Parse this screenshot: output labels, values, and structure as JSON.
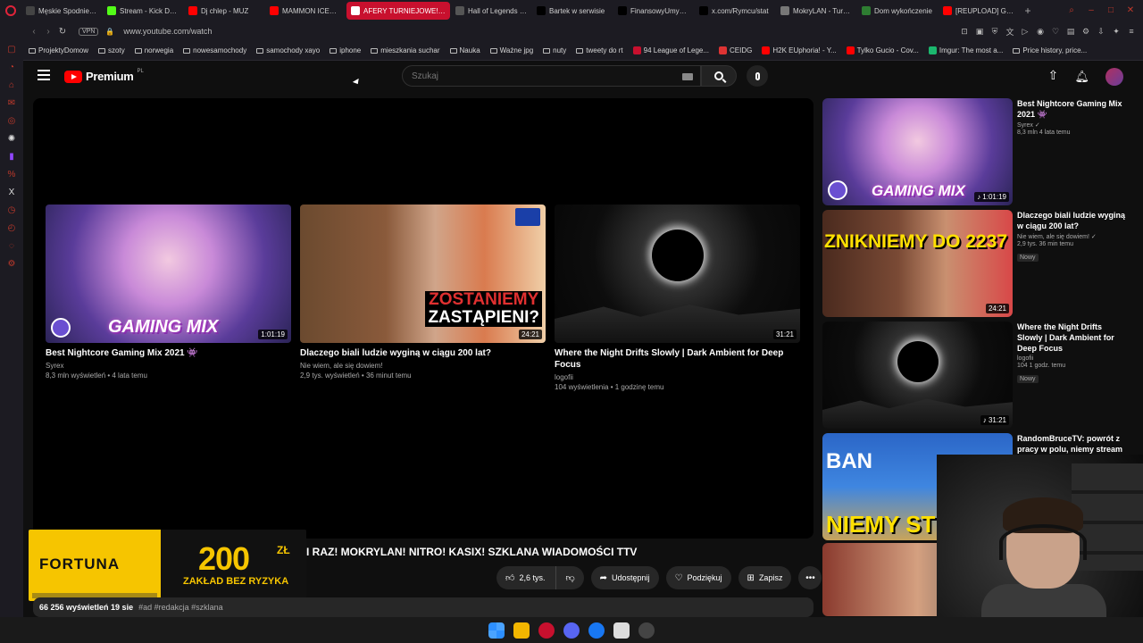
{
  "browser": {
    "tabs": [
      {
        "label": "Męskie Spodnie TH",
        "color": "#444"
      },
      {
        "label": "Stream - Kick Dash",
        "color": "#53fc18"
      },
      {
        "label": "Dj chlep - MUZ",
        "color": "#ff0000"
      },
      {
        "label": "MAMMON ICEBERG",
        "color": "#ff0000"
      },
      {
        "label": "AFERY TURNIEJOWE! MA",
        "color": "#ff0000",
        "active": true
      },
      {
        "label": "Hall of Legends - L",
        "color": "#555"
      },
      {
        "label": "Bartek w serwisie",
        "color": "#000"
      },
      {
        "label": "FinansowyUmysł w",
        "color": "#000"
      },
      {
        "label": "x.com/Rymcu/stat",
        "color": "#000"
      },
      {
        "label": "MokryLAN - Turnie",
        "color": "#777"
      },
      {
        "label": "Dom wykończenie",
        "color": "#2e7d32"
      },
      {
        "label": "[REUPLOAD] Głow",
        "color": "#ff0000"
      }
    ],
    "vpn": "VPN",
    "url": "www.youtube.com/watch",
    "bookmarks": [
      {
        "label": "ProjektyDomow",
        "kind": "folder"
      },
      {
        "label": "szoty",
        "kind": "folder"
      },
      {
        "label": "norwegia",
        "kind": "folder"
      },
      {
        "label": "nowesamochody",
        "kind": "folder"
      },
      {
        "label": "samochody xayo",
        "kind": "folder"
      },
      {
        "label": "iphone",
        "kind": "folder"
      },
      {
        "label": "mieszkania suchar",
        "kind": "folder"
      },
      {
        "label": "Nauka",
        "kind": "folder"
      },
      {
        "label": "Ważne jpg",
        "kind": "folder"
      },
      {
        "label": "nuty",
        "kind": "folder"
      },
      {
        "label": "tweety do rt",
        "kind": "folder"
      },
      {
        "label": "94 League of Lege...",
        "kind": "site",
        "color": "#c8102e"
      },
      {
        "label": "CEIDG",
        "kind": "site",
        "color": "#d33"
      },
      {
        "label": "H2K EUphoria! - Y...",
        "kind": "site",
        "color": "#ff0000"
      },
      {
        "label": "Tylko Gucio - Cov...",
        "kind": "site",
        "color": "#ff0000"
      },
      {
        "label": "Imgur: The most a...",
        "kind": "site",
        "color": "#1bb76e"
      },
      {
        "label": "Price history, price...",
        "kind": "folder"
      }
    ]
  },
  "youtube": {
    "logo_text": "Premium",
    "logo_region": "PL",
    "search_placeholder": "Szukaj",
    "endscreen": [
      {
        "title": "Best Nightcore Gaming Mix 2021 👾",
        "channel": "Syrex",
        "meta": "8,3 mln wyświetleń • 4 lata temu",
        "duration": "1:01:19",
        "overlay": "GAMING MIX"
      },
      {
        "title": "Dlaczego biali ludzie wyginą w ciągu 200 lat?",
        "channel": "Nie wiem, ale się dowiem!",
        "meta": "2,9 tys. wyświetleń • 36 minut temu",
        "duration": "24:21",
        "overlay1": "ZOSTANIEMY",
        "overlay2": "ZASTĄPIENI?"
      },
      {
        "title": "Where the Night Drifts Slowly | Dark Ambient for Deep Focus",
        "channel": "logofii",
        "meta": "104 wyświetlenia • 1 godzinę temu",
        "duration": "31:21"
      }
    ],
    "video_title": "I RAZ! MOKRYLAN! NITRO! KASIX! SZKLANA WIADOMOŚCI TTV",
    "actions": {
      "likes": "2,6 tys.",
      "share": "Udostępnij",
      "thanks": "Podziękuj",
      "save": "Zapisz"
    },
    "description": {
      "stats": "66 256 wyświetleń  19 sie",
      "tags": "#ad #redakcja #szklana"
    },
    "ad": {
      "brand": "FORTUNA",
      "amount": "200",
      "currency": "ZŁ",
      "subtitle": "ZAKŁAD BEZ RYZYKA"
    },
    "recommendations": [
      {
        "title": "Best Nightcore Gaming Mix 2021 👾",
        "channel": "Syrex ✓",
        "meta": "8,3 mln  4 lata temu",
        "duration": "♪ 1:01:19",
        "overlay": "GAMING MIX"
      },
      {
        "title": "Dlaczego biali ludzie wyginą w ciągu 200 lat?",
        "channel": "Nie wiem, ale się dowiem! ✓",
        "meta": "2,9 tys.  36 min temu",
        "duration": "24:21",
        "badge": "Nowy",
        "overlay": "ZNIKNIEMY DO 2237"
      },
      {
        "title": "Where the Night Drifts Slowly | Dark Ambient for Deep Focus",
        "channel": "logofii",
        "meta": "104  1 godz. temu",
        "duration": "♪ 31:21",
        "badge": "Nowy"
      },
      {
        "title": "RandomBruceTV: powrót z pracy w polu, niemy stream i",
        "overlay1": "BAN",
        "overlay2": "NIEMY ST"
      }
    ]
  }
}
